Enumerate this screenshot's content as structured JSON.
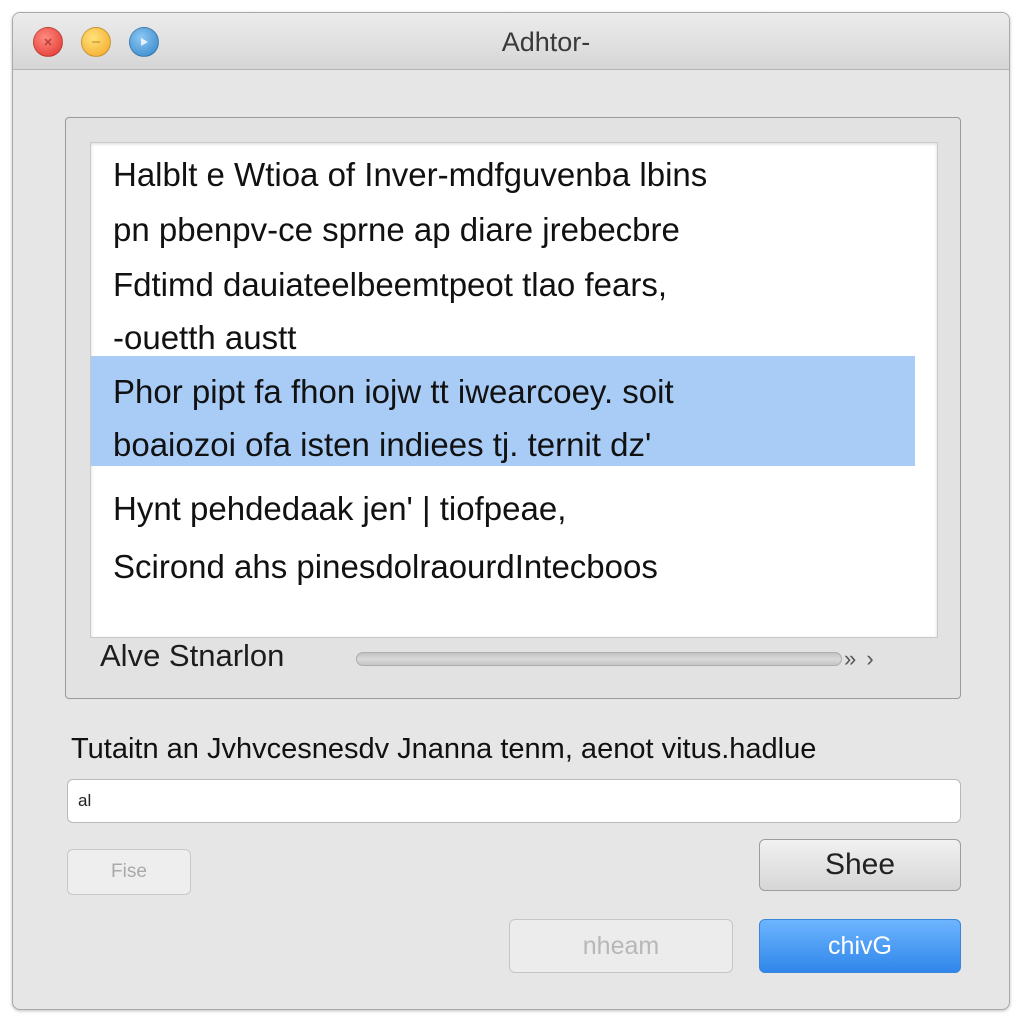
{
  "window": {
    "title": "Adhtor-"
  },
  "colors": {
    "accent": "#3f95f2",
    "selection": "#a9ccf6",
    "close": "#e0332c",
    "minimize": "#f3a524",
    "zoom": "#2f83c8"
  },
  "icons": {
    "close": "close-icon",
    "minimize": "minimize-icon",
    "zoom": "zoom-icon"
  },
  "content": {
    "lines": [
      "Halblt e Wtioa of Inver-mdfguvenba lbins",
      "pn pbenpv-ce sprne ap diare jrebecbre",
      "Fdtimd dauiateelbeemtpeot tlao fears,",
      "-ouetth austt",
      "Phor pipt fa fhon iojw tt iwearcoey. soit",
      "boaiozoi ofa isten indiees tj. ternit dz'",
      "Hynt pehdedaak jen' | tiofpeae,",
      "Scirond ahs pinesdolraourdIntecboos"
    ],
    "footer_label": "Alve Stnarlon",
    "scroll_arrows": "» ›"
  },
  "prompt": {
    "label": "Tutaitn an Jvhvcesnesdv Jnanna tenm, aenot vitus.hadlue",
    "input_value": "al",
    "input_placeholder": ""
  },
  "buttons": {
    "files": "Fise",
    "share": "Shee",
    "secondary": "nheam",
    "primary": "chivG"
  }
}
